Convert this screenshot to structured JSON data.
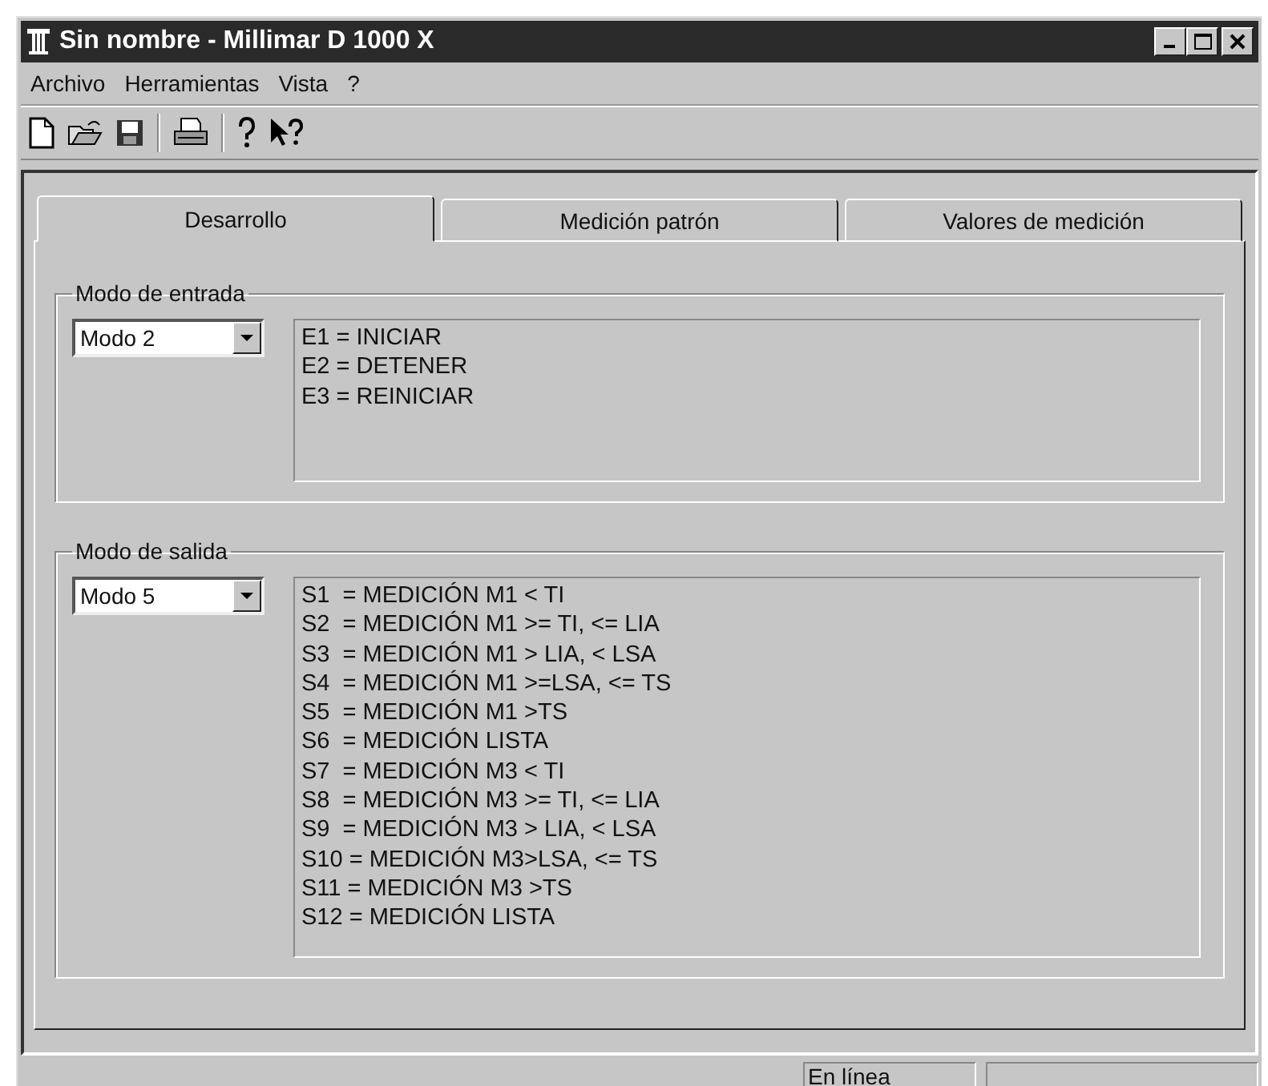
{
  "window": {
    "title": "Sin nombre - Millimar D 1000 X"
  },
  "menu": [
    "Archivo",
    "Herramientas",
    "Vista",
    "?"
  ],
  "toolbar": [
    {
      "kind": "new"
    },
    {
      "kind": "open"
    },
    {
      "kind": "save"
    },
    {
      "kind": "separator"
    },
    {
      "kind": "print"
    },
    {
      "kind": "separator"
    },
    {
      "kind": "help"
    },
    {
      "kind": "context-help"
    }
  ],
  "tabs": [
    {
      "label": "Desarrollo",
      "selected": true
    },
    {
      "label": "Medición patrón",
      "selected": false
    },
    {
      "label": "Valores de medición",
      "selected": false
    }
  ],
  "groups": [
    {
      "title": "Modo de entrada",
      "mode": "Modo 2",
      "lines": [
        "E1 = INICIAR",
        "E2 = DETENER",
        "E3 = REINICIAR"
      ]
    },
    {
      "title": "Modo de salida",
      "mode": "Modo 5",
      "lines": [
        "S1  = MEDICIÓN M1 < TI",
        "S2  = MEDICIÓN M1 >= TI, <= LIA",
        "S3  = MEDICIÓN M1 > LIA, < LSA",
        "S4  = MEDICIÓN M1 >=LSA, <= TS",
        "S5  = MEDICIÓN M1 >TS",
        "S6  = MEDICIÓN LISTA",
        "S7  = MEDICIÓN M3 < TI",
        "S8  = MEDICIÓN M3 >= TI, <= LIA",
        "S9  = MEDICIÓN M3 > LIA, < LSA",
        "S10 = MEDICIÓN M3>LSA, <= TS",
        "S11 = MEDICIÓN M3 >TS",
        "S12 = MEDICIÓN LISTA"
      ]
    }
  ],
  "status_bar": {
    "connection": "En línea"
  }
}
